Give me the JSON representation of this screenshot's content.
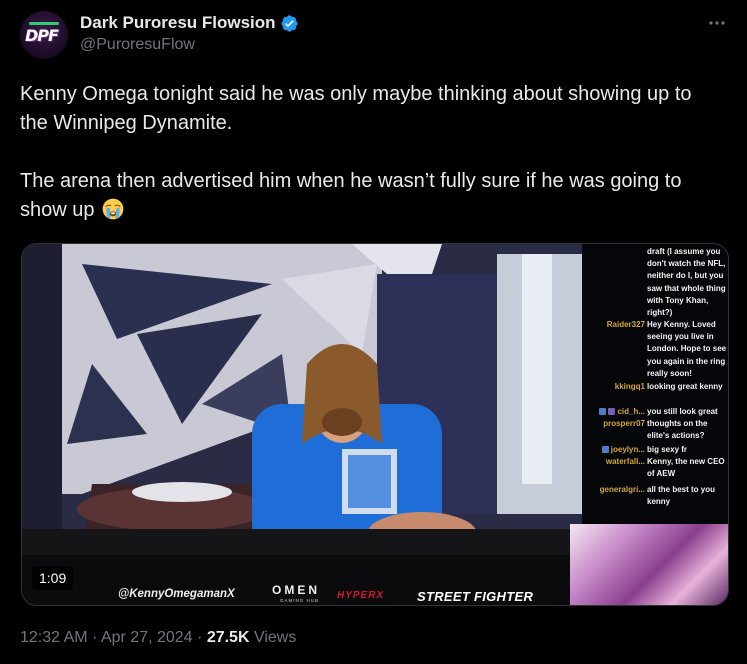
{
  "author": {
    "display_name": "Dark Puroresu Flowsion",
    "handle": "@PuroresuFlow",
    "avatar_text": "DPF",
    "verified": true
  },
  "tweet": {
    "paragraph_1": "Kenny Omega tonight said he was only maybe thinking about showing up to the Winnipeg Dynamite.",
    "paragraph_2": "The arena then advertised him when he wasn’t fully sure if he was going to show up",
    "emoji": "loudly-crying-face"
  },
  "media": {
    "duration": "1:09",
    "overlay": {
      "handle": "@KennyOmegamanX",
      "omen": "OMEN",
      "omen_sub": "GAMING HUB",
      "hyperx": "HYPERX",
      "street_fighter": "STREET FIGHTER"
    },
    "chat": [
      {
        "user": "",
        "message": "draft (I assume you don't watch the NFL, neither do I, but you saw that whole thing with Tony Khan, right?)"
      },
      {
        "user": "Raider327",
        "message": "Hey Kenny. Loved seeing you live in London. Hope to see you again in the ring really soon!"
      },
      {
        "user": "kkingq1",
        "message": "looking great kenny"
      },
      {
        "user": "cid_h...",
        "message": "you still look great"
      },
      {
        "user": "prosperr07",
        "message": "thoughts on the elite's actions?"
      },
      {
        "user": "joeylyn...",
        "message": "big sexy fr"
      },
      {
        "user": "waterfall...",
        "message": "Kenny, the new CEO of AEW"
      },
      {
        "user": "generalgri...",
        "message": "all the best to you kenny"
      }
    ]
  },
  "meta": {
    "time": "12:32 AM",
    "separator": "·",
    "date": "Apr 27, 2024",
    "views_count": "27.5K",
    "views_label": "Views"
  },
  "colors": {
    "background": "#000000",
    "text_primary": "#e7e9ea",
    "text_secondary": "#71767b",
    "verified": "#1d9bf0",
    "border": "#2f3336"
  }
}
